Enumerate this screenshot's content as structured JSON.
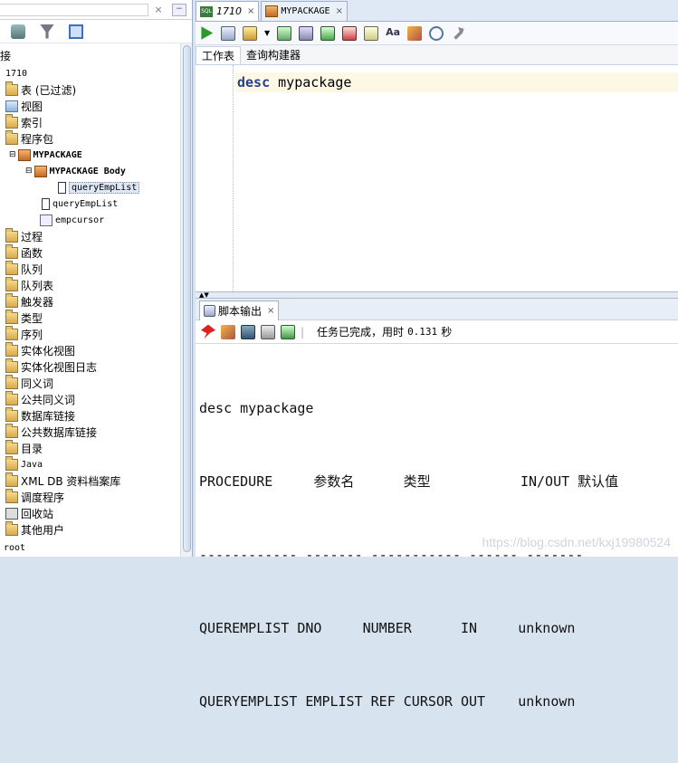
{
  "doc_tabs": [
    {
      "badge": "SQL",
      "label": "1710",
      "active": true
    },
    {
      "label": "MYPACKAGE",
      "active": false
    }
  ],
  "sub_tabs": [
    "工作表",
    "查询构建器"
  ],
  "editor": {
    "keyword": "desc",
    "rest": " mypackage"
  },
  "output_tab": "脚本输出",
  "status": {
    "text": "任务已完成，用时",
    "time": "0.131",
    "unit": "秒"
  },
  "output_lines": [
    "desc mypackage",
    "PROCEDURE     参数名      类型           IN/OUT 默认值",
    "------------ ------- ----------- ------ -------",
    "QUEREMPLIST DNO     NUMBER      IN     unknown",
    "QUERYEMPLIST EMPLIST REF CURSOR OUT    unknown"
  ],
  "watermark": "https://blog.csdn.net/kxj19980524",
  "tree": {
    "header_fragment": "接",
    "connection": "1710",
    "items": [
      {
        "label": "表 (已过滤)",
        "icon": "folder-icon"
      },
      {
        "label": "视图",
        "icon": "view-folder-icon"
      },
      {
        "label": "索引",
        "icon": "folder-icon"
      },
      {
        "label": "程序包",
        "icon": "folder-icon"
      },
      {
        "label": "MYPACKAGE",
        "icon": "package-icon"
      },
      {
        "label": "MYPACKAGE Body",
        "icon": "package-body-icon"
      },
      {
        "label": "queryEmpList",
        "icon": "procedure-icon"
      },
      {
        "label": "queryEmpList",
        "icon": "procedure-icon"
      },
      {
        "label": "empcursor",
        "icon": "variable-icon"
      },
      {
        "label": "过程",
        "icon": "folder-icon"
      },
      {
        "label": "函数",
        "icon": "folder-icon"
      },
      {
        "label": "队列",
        "icon": "folder-icon"
      },
      {
        "label": "队列表",
        "icon": "folder-icon"
      },
      {
        "label": "触发器",
        "icon": "folder-icon"
      },
      {
        "label": "类型",
        "icon": "folder-icon"
      },
      {
        "label": "序列",
        "icon": "folder-icon"
      },
      {
        "label": "实体化视图",
        "icon": "folder-icon"
      },
      {
        "label": "实体化视图日志",
        "icon": "folder-icon"
      },
      {
        "label": "同义词",
        "icon": "folder-icon"
      },
      {
        "label": "公共同义词",
        "icon": "folder-icon"
      },
      {
        "label": "数据库链接",
        "icon": "folder-icon"
      },
      {
        "label": "公共数据库链接",
        "icon": "folder-icon"
      },
      {
        "label": "目录",
        "icon": "folder-icon"
      },
      {
        "label": "Java",
        "icon": "folder-icon"
      },
      {
        "label": "XML DB 资料档案库",
        "icon": "folder-icon"
      },
      {
        "label": "调度程序",
        "icon": "folder-icon"
      },
      {
        "label": "回收站",
        "icon": "recycle-bin-icon"
      },
      {
        "label": "其他用户",
        "icon": "folder-icon"
      },
      {
        "label": "root",
        "icon": ""
      }
    ]
  }
}
